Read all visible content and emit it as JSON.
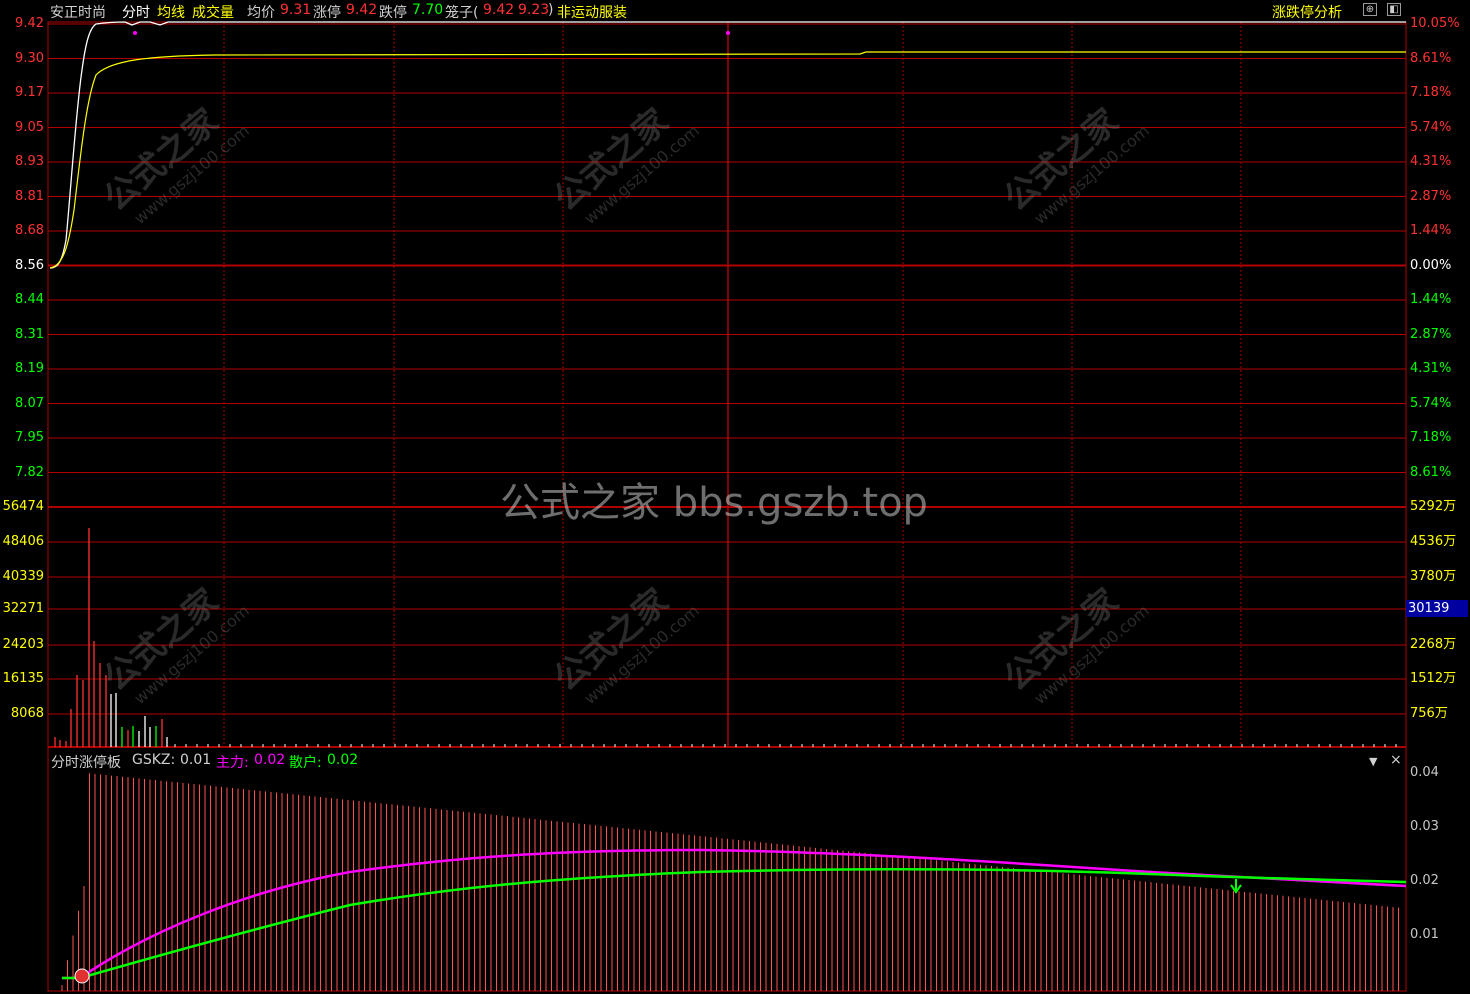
{
  "header": {
    "stock_name": "安正时尚",
    "tab_intraday": "分时",
    "tab_avg": "均线",
    "tab_volume": "成交量",
    "avg_price_label": "均价",
    "avg_price": "9.31",
    "limit_up_label": "涨停",
    "limit_up": "9.42",
    "limit_down_label": "跌停",
    "limit_down": "7.70",
    "cage_label": "笼子(",
    "cage_low": "9.42",
    "cage_high": "9.23",
    "cage_close": ")",
    "sector": "非运动服装",
    "analysis": "涨跌停分析"
  },
  "price_axis": {
    "left": [
      "9.42",
      "9.30",
      "9.17",
      "9.05",
      "8.93",
      "8.81",
      "8.68",
      "8.56",
      "8.44",
      "8.31",
      "8.19",
      "8.07",
      "7.95",
      "7.82"
    ],
    "right": [
      "10.05%",
      "8.61%",
      "7.18%",
      "5.74%",
      "4.31%",
      "2.87%",
      "1.44%",
      "0.00%",
      "1.44%",
      "2.87%",
      "4.31%",
      "5.74%",
      "7.18%",
      "8.61%"
    ]
  },
  "volume_axis": {
    "left": [
      "56474",
      "48406",
      "40339",
      "32271",
      "24203",
      "16135",
      "8068"
    ],
    "right": [
      "5292万",
      "4536万",
      "3780万",
      "",
      "2268万",
      "1512万",
      "756万"
    ],
    "current": "30139"
  },
  "indicator": {
    "title": "分时涨停板",
    "gskz_label": "GSKZ:",
    "gskz_value": "0.01",
    "main_label": "主力:",
    "main_value": "0.02",
    "retail_label": "散户:",
    "retail_value": "0.02",
    "axis": [
      "0.04",
      "0.03",
      "0.02",
      "0.01"
    ],
    "dropdown": "▼",
    "close": "×"
  },
  "watermarks": {
    "center": "公式之家 bbs.gszb.top",
    "diag_cn": "公式之家",
    "diag_url": "www.gszj100.com"
  },
  "colors": {
    "grid": "#b00000",
    "up": "#ff3232",
    "down": "#00ff00",
    "price_line": "#ffffff",
    "avg_line": "#ffff00",
    "main_line": "#ff00ff",
    "retail_line": "#00ff00",
    "volume_axis": "#ffff00"
  }
}
